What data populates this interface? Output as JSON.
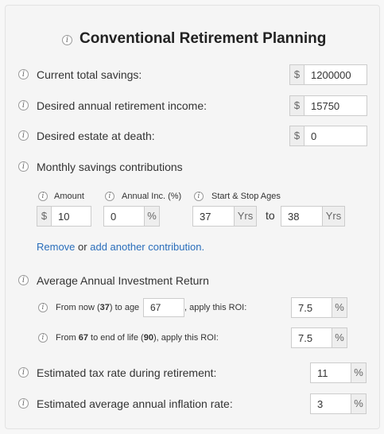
{
  "title": "Conventional Retirement Planning",
  "fields": {
    "current_savings": {
      "label": "Current total savings:",
      "prefix": "$",
      "value": "1200000"
    },
    "desired_income": {
      "label": "Desired annual retirement income:",
      "prefix": "$",
      "value": "15750"
    },
    "desired_estate": {
      "label": "Desired estate at death:",
      "prefix": "$",
      "value": "0"
    }
  },
  "contributions": {
    "label": "Monthly savings contributions",
    "amount_label": "Amount",
    "amount_prefix": "$",
    "amount_value": "10",
    "annual_inc_label": "Annual Inc. (%)",
    "annual_inc_value": "0",
    "annual_inc_suffix": "%",
    "ages_label": "Start & Stop Ages",
    "start_age": "37",
    "stop_age": "38",
    "yrs_suffix": "Yrs",
    "to_text": "to",
    "remove_link": "Remove",
    "or_text": "or",
    "add_link": "add another contribution",
    "period": "."
  },
  "roi": {
    "label": "Average Annual Investment Return",
    "row1": {
      "pre": "From now (",
      "age_now": "37",
      "mid": ") to age",
      "age_value": "67",
      "post": ", apply this ROI:",
      "roi_value": "7.5",
      "suffix": "%"
    },
    "row2": {
      "pre": "From ",
      "age_from": "67",
      "mid": " to end of life (",
      "age_end": "90",
      "post": "), apply this ROI:",
      "roi_value": "7.5",
      "suffix": "%"
    }
  },
  "tax": {
    "label": "Estimated tax rate during retirement:",
    "value": "11",
    "suffix": "%"
  },
  "inflation": {
    "label": "Estimated average annual inflation rate:",
    "value": "3",
    "suffix": "%"
  },
  "icons": {
    "info": "i"
  }
}
